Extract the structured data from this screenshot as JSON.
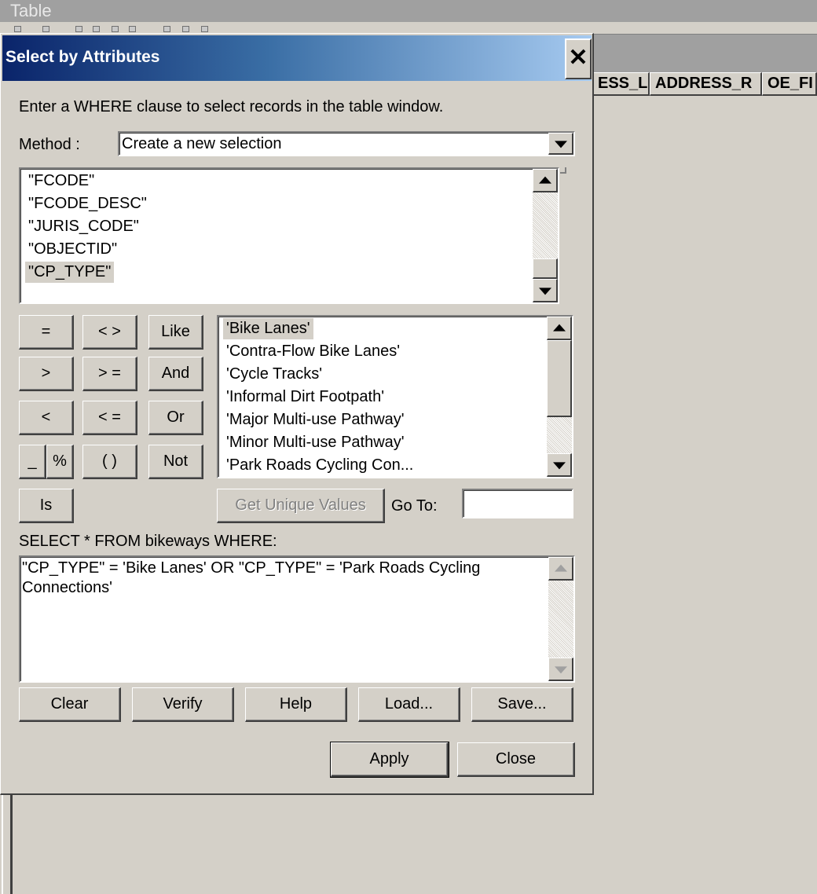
{
  "background_window": {
    "title": "Table",
    "columns": [
      "ESS_L",
      "ADDRESS_R",
      "OE_FI"
    ]
  },
  "dialog": {
    "title": "Select by Attributes",
    "close_glyph": "✕",
    "instruction": "Enter a WHERE clause to select records in the table window.",
    "method_label": "Method :",
    "method_value": "Create a new selection",
    "fields": [
      "\"FCODE\"",
      "\"FCODE_DESC\"",
      "\"JURIS_CODE\"",
      "\"OBJECTID\"",
      "\"CP_TYPE\""
    ],
    "selected_field": "\"CP_TYPE\"",
    "operators": {
      "eq": "=",
      "ne": "< >",
      "like": "Like",
      "gt": ">",
      "ge": "> =",
      "and": "And",
      "lt": "<",
      "le": "< =",
      "or": "Or",
      "underscore": "_",
      "percent": "%",
      "parens": "( )",
      "not": "Not",
      "is": "Is"
    },
    "values": [
      "'Bike Lanes'",
      "'Contra-Flow Bike Lanes'",
      "'Cycle Tracks'",
      "'Informal Dirt Footpath'",
      "'Major Multi-use Pathway'",
      "'Minor Multi-use Pathway'",
      "'Park Roads Cycling Con..."
    ],
    "selected_value": "'Bike Lanes'",
    "get_unique_values_label": "Get Unique Values",
    "goto_label": "Go To:",
    "goto_value": "",
    "select_prefix": "SELECT * FROM bikeways WHERE:",
    "where_clause": "\"CP_TYPE\" = 'Bike Lanes' OR \"CP_TYPE\" = 'Park Roads Cycling Connections'",
    "buttons": {
      "clear": "Clear",
      "verify": "Verify",
      "help": "Help",
      "load": "Load...",
      "save": "Save...",
      "apply": "Apply",
      "close": "Close"
    }
  }
}
